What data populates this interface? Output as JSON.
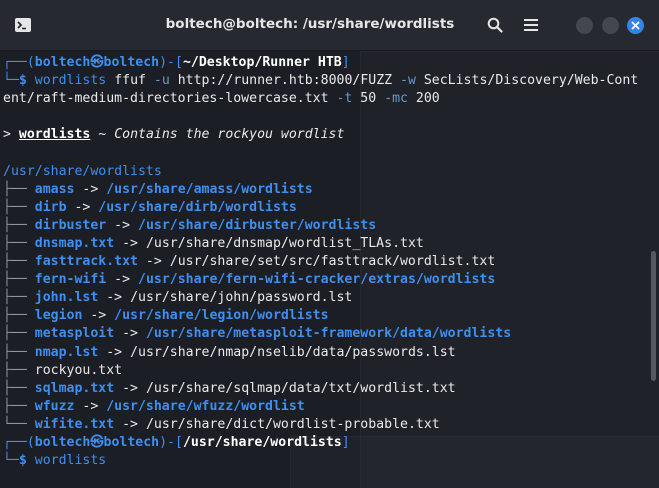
{
  "window": {
    "title": "boltech@boltech: /usr/share/wordlists",
    "new_tab_icon": "terminal-new-tab-icon",
    "search_icon": "search-icon",
    "menu_icon": "hamburger-menu-icon",
    "close_icon": "close-icon",
    "accent_color": "#3584e4"
  },
  "terminal": {
    "prompt1": {
      "user": "boltech",
      "host": "boltech",
      "cwd": "~/Desktop/Runner HTB",
      "command": "wordlists",
      "args_part1": " ffuf ",
      "flag_u": "-u",
      "url": " http://runner.htb:8000/FUZZ ",
      "flag_w": "-w",
      "wordlist_part1": " SecLists/Discovery/Web-Cont",
      "wordlist_part2": "ent/raft-medium-directories-lowercase.txt ",
      "flag_t": "-t",
      "t_val": " 50 ",
      "flag_mc": "-mc",
      "mc_val": " 200"
    },
    "desc": {
      "arrow": "> ",
      "name": "wordlists",
      "tilde": " ~ ",
      "text": "Contains the rockyou wordlist"
    },
    "root_dir": "/usr/share/wordlists",
    "entries": [
      {
        "branch": "├── ",
        "name": "amass",
        "arrow": " -> ",
        "target": "/usr/share/amass/wordlists",
        "target_dir": true
      },
      {
        "branch": "├── ",
        "name": "dirb",
        "arrow": " -> ",
        "target": "/usr/share/dirb/wordlists",
        "target_dir": true
      },
      {
        "branch": "├── ",
        "name": "dirbuster",
        "arrow": " -> ",
        "target": "/usr/share/dirbuster/wordlists",
        "target_dir": true
      },
      {
        "branch": "├── ",
        "name": "dnsmap.txt",
        "arrow": " -> ",
        "target": "/usr/share/dnsmap/wordlist_TLAs.txt",
        "target_dir": false
      },
      {
        "branch": "├── ",
        "name": "fasttrack.txt",
        "arrow": " -> ",
        "target": "/usr/share/set/src/fasttrack/wordlist.txt",
        "target_dir": false
      },
      {
        "branch": "├── ",
        "name": "fern-wifi",
        "arrow": " -> ",
        "target": "/usr/share/fern-wifi-cracker/extras/wordlists",
        "target_dir": true
      },
      {
        "branch": "├── ",
        "name": "john.lst",
        "arrow": " -> ",
        "target": "/usr/share/john/password.lst",
        "target_dir": false
      },
      {
        "branch": "├── ",
        "name": "legion",
        "arrow": " -> ",
        "target": "/usr/share/legion/wordlists",
        "target_dir": true
      },
      {
        "branch": "├── ",
        "name": "metasploit",
        "arrow": " -> ",
        "target": "/usr/share/metasploit-framework/data/wordlists",
        "target_dir": true
      },
      {
        "branch": "├── ",
        "name": "nmap.lst",
        "arrow": " -> ",
        "target": "/usr/share/nmap/nselib/data/passwords.lst",
        "target_dir": false
      },
      {
        "branch": "├── ",
        "name": "rockyou.txt",
        "arrow": "",
        "target": "",
        "plain": true
      },
      {
        "branch": "├── ",
        "name": "sqlmap.txt",
        "arrow": " -> ",
        "target": "/usr/share/sqlmap/data/txt/wordlist.txt",
        "target_dir": false
      },
      {
        "branch": "├── ",
        "name": "wfuzz",
        "arrow": " -> ",
        "target": "/usr/share/wfuzz/wordlist",
        "target_dir": true
      },
      {
        "branch": "└── ",
        "name": "wifite.txt",
        "arrow": " -> ",
        "target": "/usr/share/dict/wordlist-probable.txt",
        "target_dir": false
      }
    ],
    "prompt2": {
      "user": "boltech",
      "host": "boltech",
      "cwd": "/usr/share/wordlists",
      "command": "wordlists"
    },
    "prompt_glyphs": {
      "top_left": "┌──(",
      "at": "㉿",
      "mid": ")-[",
      "end": "]",
      "bottom_left": "└─",
      "dollar": "$ "
    }
  }
}
